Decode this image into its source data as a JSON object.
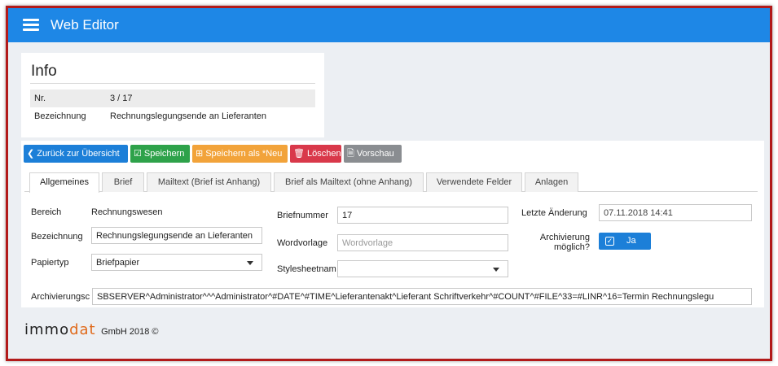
{
  "app": {
    "title": "Web Editor"
  },
  "info": {
    "title": "Info",
    "rows": [
      {
        "label": "Nr.",
        "value": "3 / 17"
      },
      {
        "label": "Bezeichnung",
        "value": "Rechnungslegungsende an Lieferanten"
      }
    ]
  },
  "toolbar": {
    "back": "Zurück zur Übersicht",
    "save": "Speichern",
    "save_new": "Speichern als *Neu",
    "delete": "Löschen",
    "preview": "Vorschau"
  },
  "tabs": [
    {
      "label": "Allgemeines",
      "active": true
    },
    {
      "label": "Brief",
      "active": false
    },
    {
      "label": "Mailtext (Brief ist Anhang)",
      "active": false
    },
    {
      "label": "Brief als Mailtext (ohne Anhang)",
      "active": false
    },
    {
      "label": "Verwendete Felder",
      "active": false
    },
    {
      "label": "Anlagen",
      "active": false
    }
  ],
  "form": {
    "bereich": {
      "label": "Bereich",
      "value": "Rechnungswesen"
    },
    "bezeichnung": {
      "label": "Bezeichnung",
      "value": "Rechnungslegungsende an Lieferanten"
    },
    "papiertyp": {
      "label": "Papiertyp",
      "value": "Briefpapier"
    },
    "briefnummer": {
      "label": "Briefnummer",
      "value": "17"
    },
    "wordvorlage": {
      "label": "Wordvorlage",
      "placeholder": "Wordvorlage",
      "value": ""
    },
    "stylesheet": {
      "label": "Stylesheetnam",
      "value": ""
    },
    "letzte_aenderung": {
      "label": "Letzte Änderung",
      "value": "07.11.2018 14:41"
    },
    "archivierung": {
      "label_line1": "Archivierung",
      "label_line2": "möglich?",
      "value": "Ja"
    },
    "archivierungsc": {
      "label": "Archivierungsc",
      "value": "SBSERVER^Administrator^^^Administrator^#DATE^#TIME^Lieferantenakt^Lieferant Schriftverkehr^#COUNT^#FILE^33=#LINR^16=Termin Rechnungslegu"
    }
  },
  "footer": {
    "logo_main": "immo",
    "logo_accent": "dat",
    "copyright": "GmbH 2018 ©"
  },
  "colors": {
    "topbar": "#1e87e6",
    "back": "#1c7fd8",
    "save": "#2ea24a",
    "save_new": "#f2a33a",
    "delete": "#d9384a",
    "preview": "#8a8d91",
    "frame_border": "#b21a1a",
    "logo_accent": "#e06a1b"
  }
}
